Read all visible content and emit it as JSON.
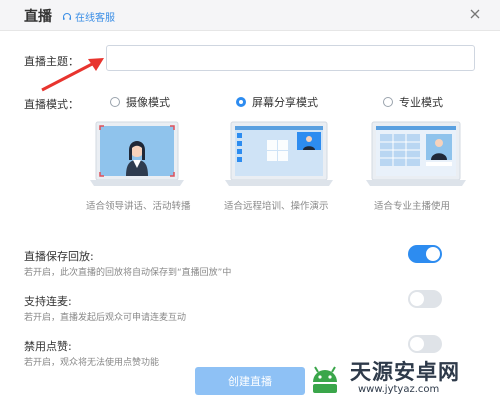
{
  "window": {
    "title": "直播",
    "support_label": "在线客服"
  },
  "topic": {
    "label": "直播主题：",
    "value": "",
    "placeholder": ""
  },
  "mode": {
    "label": "直播模式：",
    "options": [
      {
        "label": "摄像模式",
        "desc": "适合领导讲话、活动转播",
        "selected": false
      },
      {
        "label": "屏幕分享模式",
        "desc": "适合远程培训、操作演示",
        "selected": true
      },
      {
        "label": "专业模式",
        "desc": "适合专业主播使用",
        "selected": false
      }
    ]
  },
  "settings": [
    {
      "title": "直播保存回放:",
      "desc": "若开启，此次直播的回放将自动保存到“直播回放”中",
      "enabled": true
    },
    {
      "title": "支持连麦:",
      "desc": "若开启，直播发起后观众可申请连麦互动",
      "enabled": false
    },
    {
      "title": "禁用点赞:",
      "desc": "若开启，观众将无法使用点赞功能",
      "enabled": false
    }
  ],
  "create_button": {
    "label": "创建直播"
  },
  "watermark": {
    "text": "天源安卓网",
    "url": "www.jytyaz.com"
  },
  "colors": {
    "accent": "#2d8cf0",
    "annotation_arrow": "#e8342e"
  }
}
